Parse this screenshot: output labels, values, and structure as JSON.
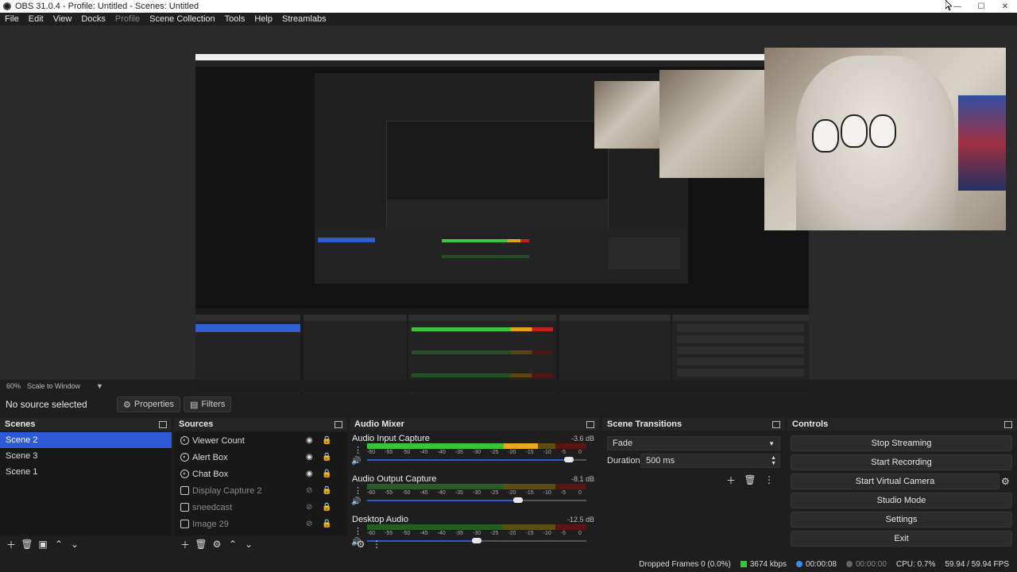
{
  "window": {
    "title": "OBS 31.0.4 - Profile: Untitled - Scenes: Untitled",
    "minimize": "—",
    "maximize": "☐",
    "close": "✕"
  },
  "menu": {
    "file": "File",
    "edit": "Edit",
    "view": "View",
    "docks": "Docks",
    "profile": "Profile",
    "scene_collection": "Scene Collection",
    "tools": "Tools",
    "help": "Help",
    "streamlabs": "Streamlabs"
  },
  "preview": {
    "zoom": "60%",
    "scale_mode": "Scale to Window"
  },
  "selection_bar": {
    "no_source": "No source selected",
    "properties_label": "Properties",
    "filters_label": "Filters"
  },
  "scenes": {
    "title": "Scenes",
    "items": [
      "Scene 2",
      "Scene 3",
      "Scene 1"
    ],
    "selected": "Scene 2"
  },
  "sources": {
    "title": "Sources",
    "items": [
      {
        "label": "Viewer Count",
        "visible": true
      },
      {
        "label": "Alert Box",
        "visible": true
      },
      {
        "label": "Chat Box",
        "visible": true
      },
      {
        "label": "Display Capture 2",
        "visible": false
      },
      {
        "label": "sneedcast",
        "visible": false
      },
      {
        "label": "Image 29",
        "visible": false
      }
    ]
  },
  "mixer": {
    "title": "Audio Mixer",
    "channels": [
      {
        "name": "Audio Input Capture",
        "db": "-3.6 dB",
        "level": 0.78,
        "fader": 0.92
      },
      {
        "name": "Audio Output Capture",
        "db": "-8.1 dB",
        "level": 0.0,
        "fader": 0.69
      },
      {
        "name": "Desktop Audio",
        "db": "-12.5 dB",
        "level": 0.0,
        "fader": 0.5
      }
    ],
    "ticks": [
      "-60",
      "-55",
      "-50",
      "-45",
      "-40",
      "-35",
      "-30",
      "-25",
      "-20",
      "-15",
      "-10",
      "-5",
      "0"
    ]
  },
  "transitions": {
    "title": "Scene Transitions",
    "selected": "Fade",
    "duration_label": "Duration",
    "duration_value": "500 ms"
  },
  "controls": {
    "title": "Controls",
    "stop_streaming": "Stop Streaming",
    "start_recording": "Start Recording",
    "start_virtual_camera": "Start Virtual Camera",
    "studio_mode": "Studio Mode",
    "settings": "Settings",
    "exit": "Exit"
  },
  "status": {
    "dropped_frames": "Dropped Frames 0 (0.0%)",
    "bitrate": "3674 kbps",
    "stream_time": "00:00:08",
    "record_time": "00:00:00",
    "cpu": "CPU: 0.7%",
    "fps": "59.94 / 59.94 FPS"
  }
}
